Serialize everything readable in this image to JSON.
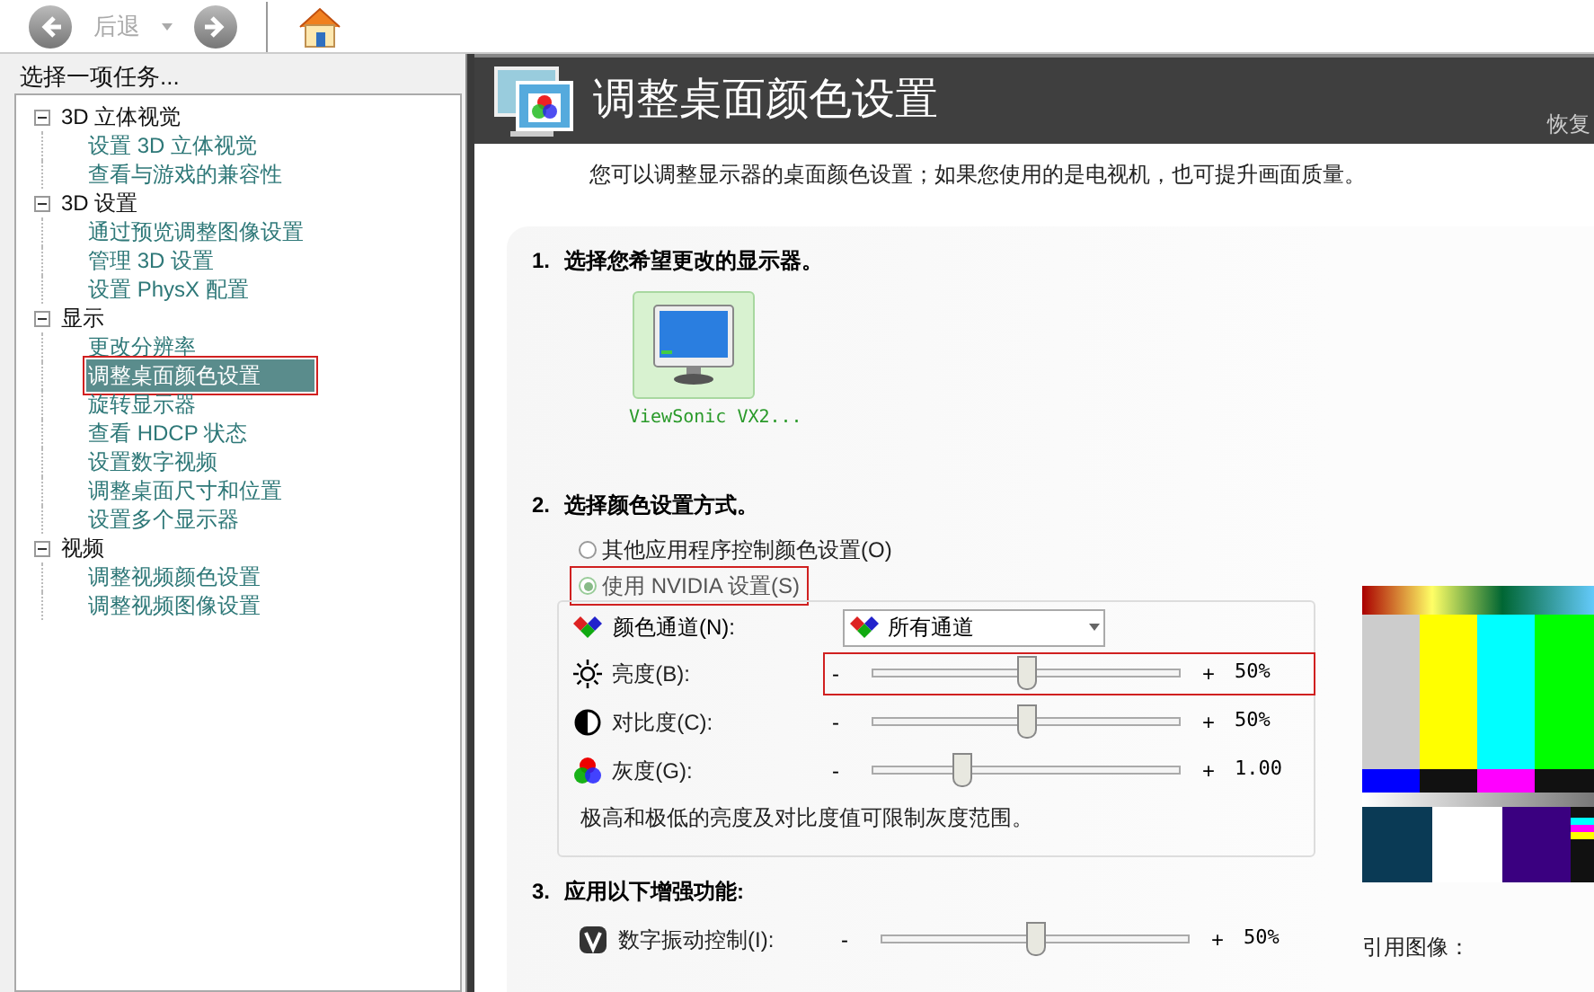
{
  "toolbar": {
    "back_label": "后退"
  },
  "task_panel": {
    "title": "选择一项任务...",
    "tree": [
      {
        "label": "3D 立体视觉",
        "expanded": true,
        "children": [
          {
            "label": "设置 3D 立体视觉",
            "selected": false,
            "marked": false
          },
          {
            "label": "查看与游戏的兼容性",
            "selected": false,
            "marked": false
          }
        ]
      },
      {
        "label": "3D 设置",
        "expanded": true,
        "children": [
          {
            "label": "通过预览调整图像设置",
            "selected": false,
            "marked": false
          },
          {
            "label": "管理 3D 设置",
            "selected": false,
            "marked": false
          },
          {
            "label": "设置 PhysX 配置",
            "selected": false,
            "marked": false
          }
        ]
      },
      {
        "label": "显示",
        "expanded": true,
        "children": [
          {
            "label": "更改分辨率",
            "selected": false,
            "marked": false
          },
          {
            "label": "调整桌面颜色设置",
            "selected": true,
            "marked": true
          },
          {
            "label": "旋转显示器",
            "selected": false,
            "marked": false
          },
          {
            "label": "查看 HDCP 状态",
            "selected": false,
            "marked": false
          },
          {
            "label": "设置数字视频",
            "selected": false,
            "marked": false
          },
          {
            "label": "调整桌面尺寸和位置",
            "selected": false,
            "marked": false
          },
          {
            "label": "设置多个显示器",
            "selected": false,
            "marked": false
          }
        ]
      },
      {
        "label": "视频",
        "expanded": true,
        "children": [
          {
            "label": "调整视频颜色设置",
            "selected": false,
            "marked": false
          },
          {
            "label": "调整视频图像设置",
            "selected": false,
            "marked": false
          }
        ]
      }
    ]
  },
  "page": {
    "title": "调整桌面颜色设置",
    "restore": "恢复",
    "description": "您可以调整显示器的桌面颜色设置；如果您使用的是电视机，也可提升画面质量。",
    "step1": {
      "number": "1.",
      "title": "选择您希望更改的显示器。",
      "displays": [
        {
          "name": "ViewSonic VX2...",
          "selected": true
        }
      ]
    },
    "step2": {
      "number": "2.",
      "title": "选择颜色设置方式。",
      "options": [
        {
          "label": "其他应用程序控制颜色设置(O)",
          "selected": false,
          "marked": false
        },
        {
          "label": "使用 NVIDIA 设置(S)",
          "selected": true,
          "marked": true
        }
      ],
      "channel": {
        "label": "颜色通道(N):",
        "value": "所有通道"
      },
      "sliders": [
        {
          "kind": "brightness",
          "label": "亮度(B):",
          "minus": "-",
          "plus": "+",
          "level": 0.5,
          "reading": "50%",
          "marked": true
        },
        {
          "kind": "contrast",
          "label": "对比度(C):",
          "minus": "-",
          "plus": "+",
          "level": 0.5,
          "reading": "50%",
          "marked": false
        },
        {
          "kind": "gamma",
          "label": "灰度(G):",
          "minus": "-",
          "plus": "+",
          "level": 0.29,
          "reading": "1.00",
          "marked": false
        }
      ],
      "note": "极高和极低的亮度及对比度值可限制灰度范围。"
    },
    "step3": {
      "number": "3.",
      "title": "应用以下增强功能:",
      "sliders": [
        {
          "kind": "vibrance",
          "label": "数字振动控制(I):",
          "minus": "-",
          "plus": "+",
          "level": 0.5,
          "reading": "50%",
          "marked": false
        }
      ]
    },
    "reference": {
      "label": "引用图像："
    }
  }
}
